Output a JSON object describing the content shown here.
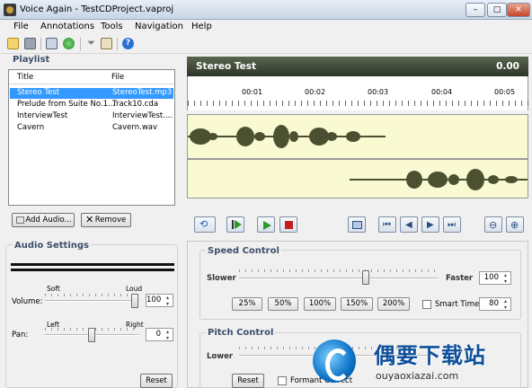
{
  "window": {
    "title": "Voice Again - TestCDProject.vaproj"
  },
  "menu": [
    "File",
    "Annotations",
    "Tools",
    "Navigation",
    "Help"
  ],
  "toolbar": {
    "icons": [
      "new-icon",
      "save-icon",
      "properties-icon",
      "refresh-icon",
      "filter-icon",
      "edit-icon",
      "help-icon"
    ]
  },
  "playlist": {
    "title": "Playlist",
    "columns": [
      "Title",
      "File"
    ],
    "rows": [
      {
        "title": "Stereo Test",
        "file": "StereoTest.mp3",
        "selected": true
      },
      {
        "title": "Prelude from Suite No.1...",
        "file": "Track10.cda"
      },
      {
        "title": "InterviewTest",
        "file": "InterviewTest...."
      },
      {
        "title": "Cavern",
        "file": "Cavern.wav"
      }
    ],
    "add_label": "Add Audio...",
    "remove_label": "Remove"
  },
  "audio_settings": {
    "title": "Audio Settings",
    "volume_label": "Volume:",
    "soft_label": "Soft",
    "loud_label": "Loud",
    "volume_value": "100",
    "pan_label": "Pan:",
    "left_label": "Left",
    "right_label": "Right",
    "pan_value": "0",
    "reset_label": "Reset"
  },
  "track": {
    "name": "Stereo Test",
    "time": "0.00",
    "ruler": [
      "00:01",
      "00:02",
      "00:03",
      "00:04",
      "00:05"
    ]
  },
  "speed": {
    "title": "Speed Control",
    "slower": "Slower",
    "faster": "Faster",
    "value": "100",
    "presets": [
      "25%",
      "50%",
      "100%",
      "150%",
      "200%"
    ],
    "smart_time_label": "Smart Time:",
    "smart_time_value": "80"
  },
  "pitch": {
    "title": "Pitch Control",
    "lower": "Lower",
    "reset_label": "Reset",
    "formant_label": "Formant Correct"
  },
  "watermark": {
    "main": "偶要下载站",
    "url": "ouyaoxiazai.com"
  },
  "colors": {
    "selection": "#3399ff",
    "waveform": "#4a5030",
    "lane": "#fafad2",
    "header": "#3d4535",
    "panel_title": "#3d4f6b"
  }
}
